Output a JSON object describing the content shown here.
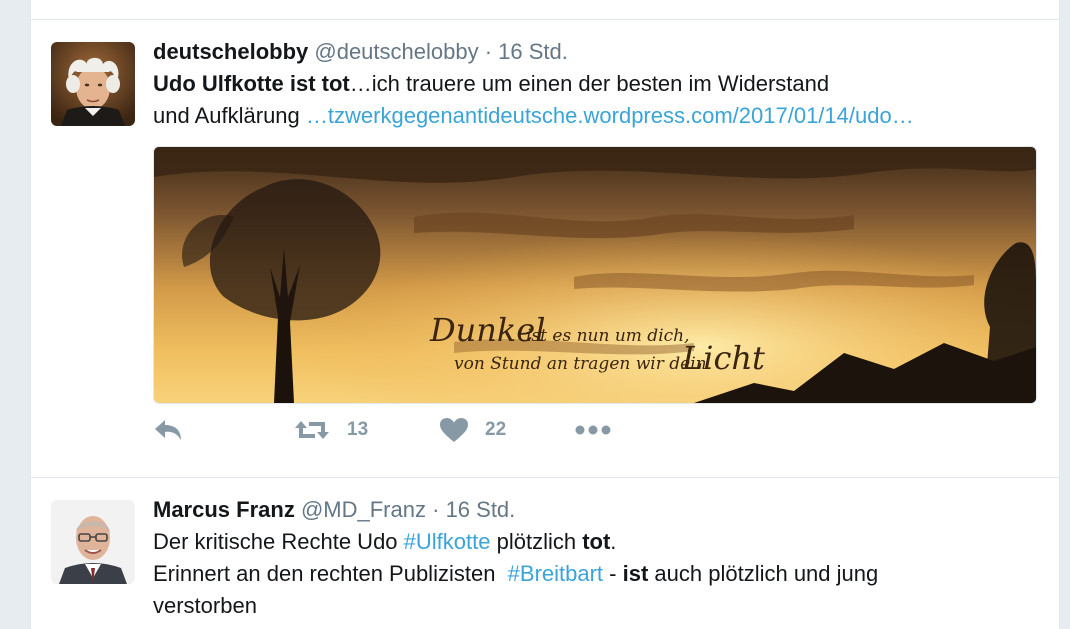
{
  "tweets": [
    {
      "fullname": "deutschelobby",
      "handle": "@deutschelobby",
      "separator": "·",
      "time": "16 Std.",
      "text": {
        "bold_lead": "Udo Ulfkotte ist tot",
        "rest_line1": "…ich trauere um einen der besten im Widerstand",
        "line2_start": "und Aufklärung ",
        "link": "…tzwerkgegenantideutsche.wordpress.com/2017/01/14/udo…"
      },
      "media": {
        "caption_word1": "Dunkel",
        "caption_line1_rest": " ist es nun um dich,",
        "caption_line2_start": "von Stund an tragen wir dein ",
        "caption_word2": "Licht",
        "caption_end": "."
      },
      "actions": {
        "reply_icon": "reply-icon",
        "retweet_icon": "retweet-icon",
        "retweet_count": "13",
        "like_icon": "heart-icon",
        "like_count": "22",
        "more_icon": "more-icon"
      }
    },
    {
      "fullname": "Marcus Franz",
      "handle": "@MD_Franz",
      "separator": "·",
      "time": "16 Std.",
      "text": {
        "l1_a": "Der kritische Rechte Udo ",
        "l1_hashtag": "#Ulfkotte",
        "l1_b": " plötzlich ",
        "l1_bold": "tot",
        "l1_c": ".",
        "l2_a": "Erinnert an den rechten Publizisten  ",
        "l2_hashtag": "#Breitbart",
        "l2_b": " - ",
        "l2_bold": "ist",
        "l2_c": " auch plötzlich und jung",
        "l3": "verstorben"
      }
    }
  ],
  "colors": {
    "link": "#3aa4d8",
    "text": "#14171a",
    "muted": "#657786",
    "action": "#8899a6",
    "background": "#e6ecf0"
  }
}
